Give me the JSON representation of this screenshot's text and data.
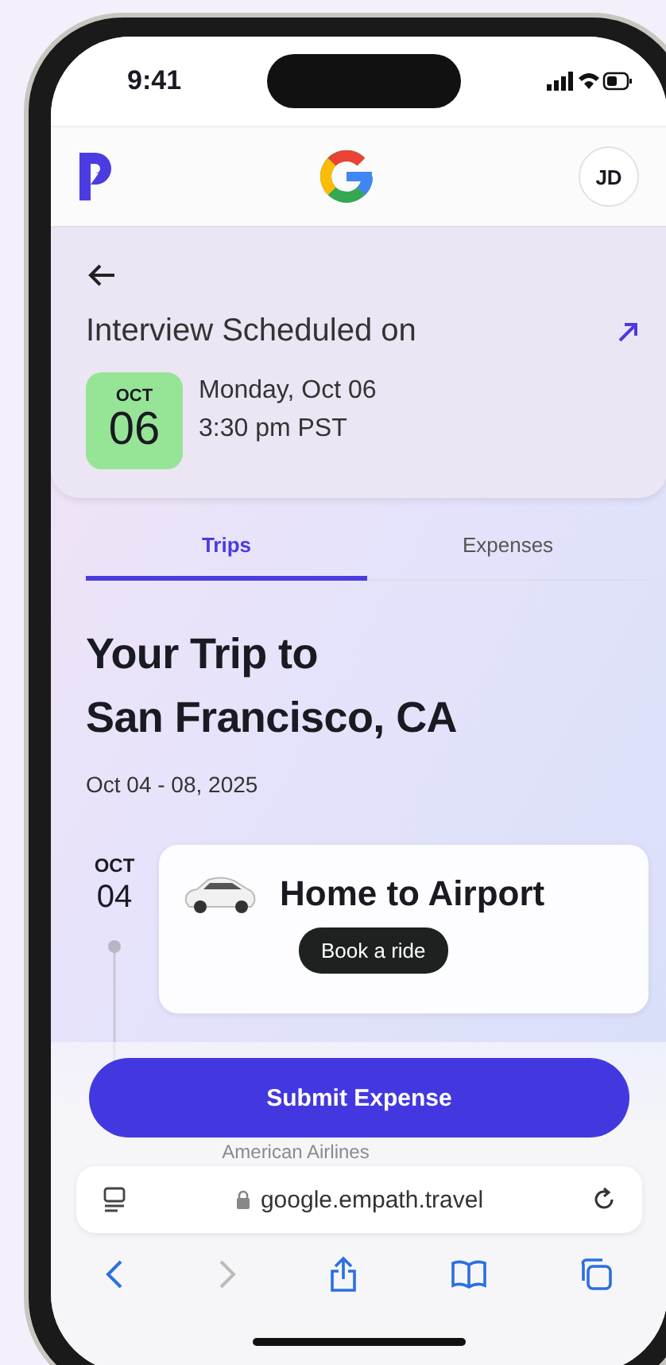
{
  "status_bar": {
    "time": "9:41"
  },
  "header": {
    "avatar": "JD"
  },
  "interview": {
    "title": "Interview Scheduled on",
    "month": "OCT",
    "day": "06",
    "date": "Monday, Oct 06",
    "time": "3:30 pm PST"
  },
  "tabs": [
    {
      "label": "Trips",
      "selected": true
    },
    {
      "label": "Expenses",
      "selected": false
    }
  ],
  "trip": {
    "title_line_1": "Your Trip to",
    "title_line_2": "San Francisco, CA",
    "dates": "Oct 04 - 08, 2025"
  },
  "timeline": [
    {
      "month": "OCT",
      "day": "04",
      "title": "Home to Airport",
      "action": "Book a ride"
    }
  ],
  "next_item": "American Airlines",
  "submit_button": "Submit Expense",
  "browser": {
    "url": "google.empath.travel"
  }
}
